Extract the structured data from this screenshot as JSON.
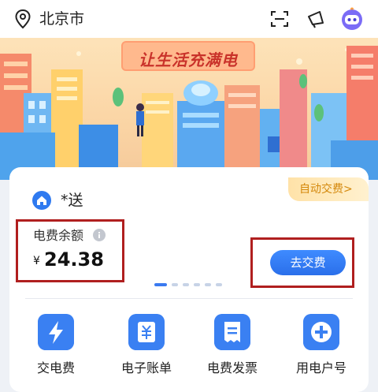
{
  "header": {
    "city": "北京市"
  },
  "banner": {
    "title": "让生活充满电"
  },
  "account": {
    "name": "*送",
    "autopay_label": "自动交费>",
    "balance_label": "电费余额",
    "currency": "¥",
    "balance": "24.38",
    "pay_button": "去交费"
  },
  "services": [
    {
      "label": "交电费",
      "icon": "lightning-icon"
    },
    {
      "label": "电子账单",
      "icon": "yuan-bill-icon"
    },
    {
      "label": "电费发票",
      "icon": "invoice-icon"
    },
    {
      "label": "用电户号",
      "icon": "plus-icon"
    }
  ],
  "colors": {
    "primary": "#2d6fe8",
    "highlight": "#b01f1f",
    "autopay": "#d4880c"
  }
}
